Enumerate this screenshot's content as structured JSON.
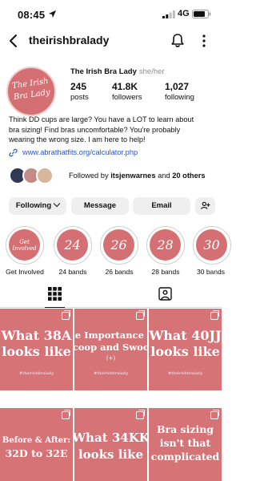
{
  "status_bar": {
    "time": "08:45",
    "network": "4G"
  },
  "header": {
    "username": "theirishbralady"
  },
  "profile": {
    "display_name": "The Irish Bra Lady",
    "pronouns": "she/her",
    "avatar_text_line1": "The Irish",
    "avatar_text_line2": "Bra Lady",
    "stats": [
      {
        "value": "245",
        "label": "posts"
      },
      {
        "value": "41.8K",
        "label": "followers"
      },
      {
        "value": "1,027",
        "label": "following"
      }
    ],
    "bio_line1": "Think DD cups are large? You have a LOT to learn about",
    "bio_line2": "bra sizing! Find bras uncomfortable? You're probably",
    "bio_line3": "wearing the wrong size. I am here to help!",
    "link": "www.abrathatfits.org/calculator.php",
    "followed_by_prefix": "Followed by",
    "followed_by_name": "itsjenwarnes",
    "followed_by_and": "and",
    "followed_by_others": "20 others"
  },
  "actions": {
    "following": "Following",
    "message": "Message",
    "email": "Email"
  },
  "highlights": [
    {
      "circle_text": "Get Involved",
      "label": "Get Involved"
    },
    {
      "circle_text": "24",
      "label": "24 bands"
    },
    {
      "circle_text": "26",
      "label": "26 bands"
    },
    {
      "circle_text": "28",
      "label": "28 bands"
    },
    {
      "circle_text": "30",
      "label": "30 bands"
    }
  ],
  "posts": [
    {
      "line1": "What 38A",
      "line2": "looks like",
      "tag": "#theirishbralady"
    },
    {
      "line1": "he Importance o",
      "line2": "Scoop and Swoop",
      "line3": "(+)",
      "tag": "#theirishbralady"
    },
    {
      "line1": "What 40JJ",
      "line2": "looks like",
      "tag": "#theirishbralady"
    },
    {
      "line1": "Before & After:",
      "line2": "32D to 32E"
    },
    {
      "line1": "What 34KK",
      "line2": "looks like"
    },
    {
      "line1": "Bra sizing",
      "line2": "isn't that",
      "line3": "complicated"
    }
  ],
  "colors": {
    "brand_pink": "#d57377",
    "link_blue": "#2a56c6",
    "button_grey": "#efefef"
  },
  "icons": [
    "location-arrow-icon",
    "signal-icon",
    "battery-icon",
    "back-chevron-icon",
    "bell-icon",
    "more-vertical-icon",
    "link-icon",
    "add-person-icon",
    "grid-icon",
    "tagged-icon",
    "carousel-icon"
  ]
}
